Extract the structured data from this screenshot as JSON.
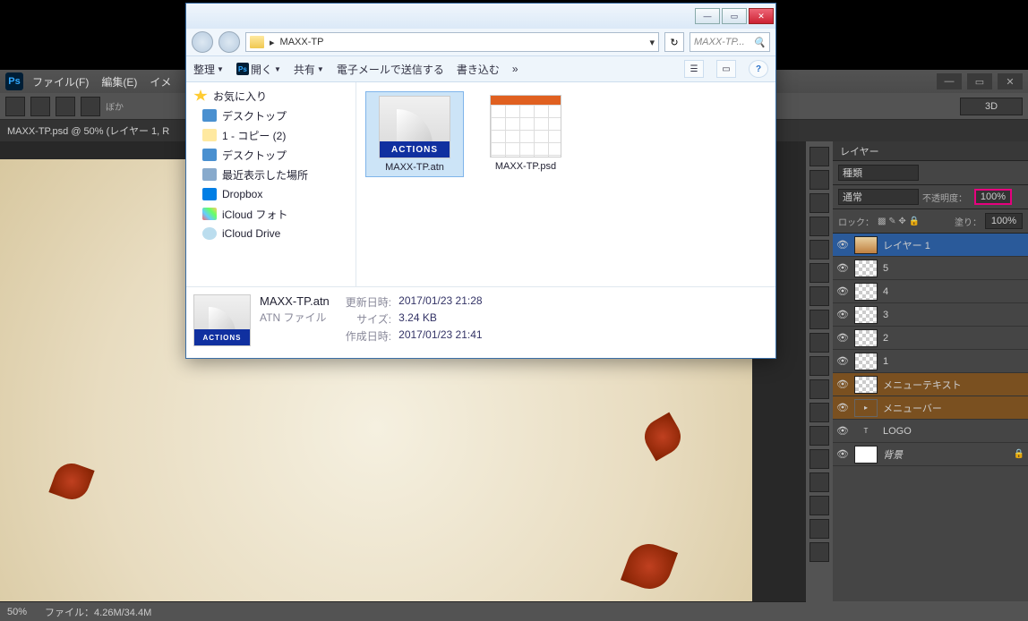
{
  "photoshop": {
    "menu_file": "ファイル(F)",
    "menu_edit": "編集(E)",
    "menu_image_cut": "イメ",
    "opt_blur_cut": "ぼか",
    "btn_3d": "3D",
    "doc_tab": "MAXX-TP.psd @ 50% (レイヤー 1, R",
    "panel_layers": "レイヤー",
    "kind_label": "種類",
    "blend_mode": "通常",
    "opacity_label": "不透明度：",
    "opacity_value": "100%",
    "lock_label": "ロック：",
    "fill_label": "塗り：",
    "fill_value": "100%",
    "layers": [
      {
        "name": "レイヤー 1",
        "thumb": "img",
        "sel": true
      },
      {
        "name": "5",
        "thumb": "chk"
      },
      {
        "name": "4",
        "thumb": "chk"
      },
      {
        "name": "3",
        "thumb": "chk"
      },
      {
        "name": "2",
        "thumb": "chk"
      },
      {
        "name": "1",
        "thumb": "chk"
      },
      {
        "name": "メニューテキスト",
        "thumb": "chk",
        "grp": true
      },
      {
        "name": "メニューバー",
        "thumb": "none",
        "grp": true
      },
      {
        "name": "LOGO",
        "thumb": "T"
      },
      {
        "name": "背景",
        "thumb": "white",
        "lock": true,
        "italic": true
      }
    ],
    "zoom": "50%",
    "status": "ファイル：4.26M/34.4M"
  },
  "explorer": {
    "path_folder": "MAXX-TP",
    "search_placeholder": "MAXX-TP...",
    "tb_organize": "整理",
    "tb_open": "開く",
    "tb_share": "共有",
    "tb_email": "電子メールで送信する",
    "tb_write": "書き込む",
    "tb_more": "»",
    "nav": {
      "fav": "お気に入り",
      "desktop1": "デスクトップ",
      "copy": "1 - コピー (2)",
      "desktop2": "デスクトップ",
      "recent": "最近表示した場所",
      "dropbox": "Dropbox",
      "icloud_photo": "iCloud フォト",
      "icloud_drive": "iCloud Drive"
    },
    "items": {
      "atn": "MAXX-TP.atn",
      "psd": "MAXX-TP.psd"
    },
    "details": {
      "filename": "MAXX-TP.atn",
      "filetype": "ATN ファイル",
      "mod_lbl": "更新日時:",
      "mod_val": "2017/01/23 21:28",
      "size_lbl": "サイズ:",
      "size_val": "3.24 KB",
      "create_lbl": "作成日時:",
      "create_val": "2017/01/23 21:41",
      "actions_bar": "ACTIONS"
    }
  }
}
